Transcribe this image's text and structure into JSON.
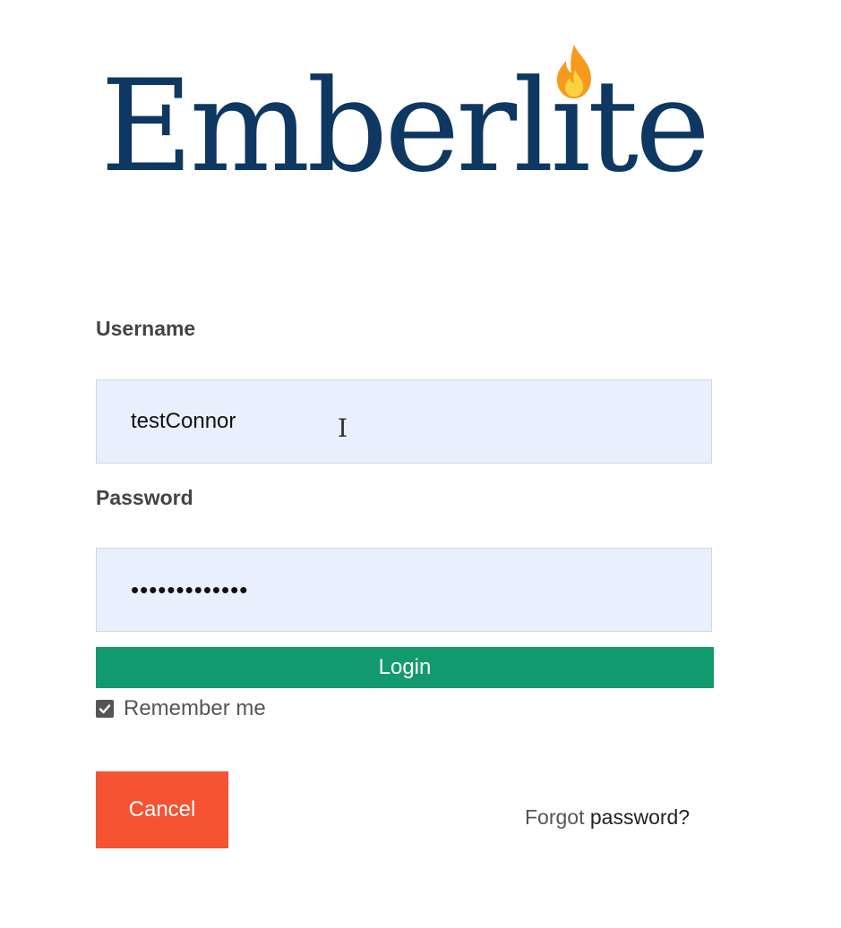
{
  "brand": {
    "name": "Emberlite",
    "color": "#0e3761",
    "flame_icon": "flame-icon"
  },
  "form": {
    "username_label": "Username",
    "username_value": "testConnor",
    "password_label": "Password",
    "password_value": "•••••••••••••",
    "login_label": "Login",
    "remember_label": "Remember me",
    "remember_checked": true,
    "cancel_label": "Cancel",
    "forgot_word1": "Forgot",
    "forgot_word2": "password?"
  },
  "colors": {
    "login": "#129a6e",
    "cancel": "#f55332",
    "input_bg": "#e8f0fe"
  }
}
